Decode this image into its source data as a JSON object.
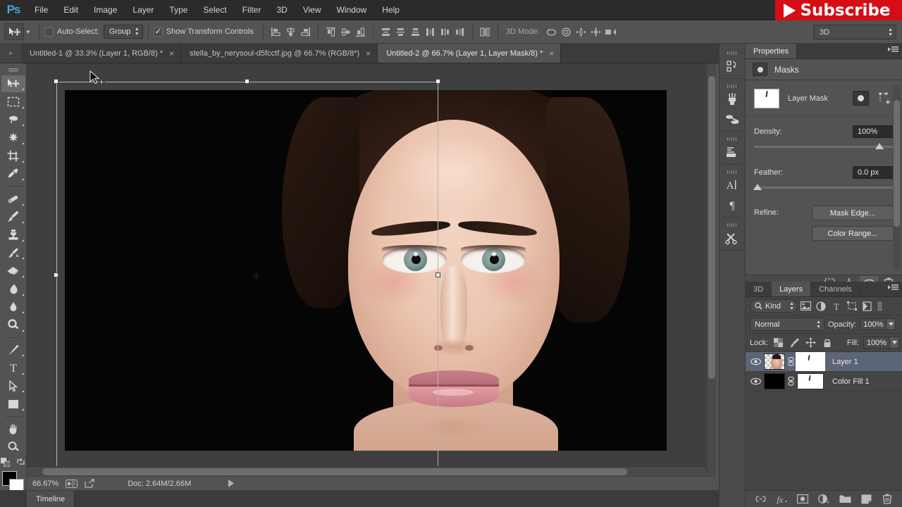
{
  "app": {
    "name": "Adobe Photoshop",
    "logo_text": "Ps"
  },
  "menubar": {
    "items": [
      {
        "label": "File"
      },
      {
        "label": "Edit"
      },
      {
        "label": "Image"
      },
      {
        "label": "Layer"
      },
      {
        "label": "Type"
      },
      {
        "label": "Select"
      },
      {
        "label": "Filter"
      },
      {
        "label": "3D"
      },
      {
        "label": "View"
      },
      {
        "label": "Window"
      },
      {
        "label": "Help"
      }
    ]
  },
  "overlay": {
    "subscribe_label": "Subscribe",
    "color": "#d60d14"
  },
  "options_bar": {
    "tool_icon": "move-tool-icon",
    "auto_select_label": "Auto-Select:",
    "auto_select_checked": false,
    "auto_select_scope": "Group",
    "show_transform_label": "Show Transform Controls",
    "show_transform_checked": true,
    "mode_3d_label": "3D Mode:",
    "workspace": "3D"
  },
  "tabs": {
    "items": [
      {
        "label": "Untitled-1 @ 33.3% (Layer 1, RGB/8) *",
        "active": false
      },
      {
        "label": "stella_by_nerysoul-d5fcctf.jpg @ 66.7% (RGB/8*)",
        "active": false
      },
      {
        "label": "Untitled-2 @ 66.7% (Layer 1, Layer Mask/8) *",
        "active": true
      }
    ],
    "close_glyph": "×"
  },
  "toolbar": {
    "tools": [
      {
        "name": "move-tool",
        "selected": true
      },
      {
        "name": "rectangular-marquee-tool",
        "selected": false
      },
      {
        "name": "lasso-tool",
        "selected": false
      },
      {
        "name": "magic-wand-tool",
        "selected": false
      },
      {
        "name": "crop-tool",
        "selected": false
      },
      {
        "name": "eyedropper-tool",
        "selected": false
      },
      {
        "name": "healing-brush-tool",
        "selected": false
      },
      {
        "name": "brush-tool",
        "selected": false
      },
      {
        "name": "clone-stamp-tool",
        "selected": false
      },
      {
        "name": "history-brush-tool",
        "selected": false
      },
      {
        "name": "eraser-tool",
        "selected": false
      },
      {
        "name": "gradient-tool",
        "selected": false
      },
      {
        "name": "blur-tool",
        "selected": false
      },
      {
        "name": "dodge-tool",
        "selected": false
      },
      {
        "name": "pen-tool",
        "selected": false
      },
      {
        "name": "type-tool",
        "selected": false
      },
      {
        "name": "path-selection-tool",
        "selected": false
      },
      {
        "name": "rectangle-tool",
        "selected": false
      },
      {
        "name": "hand-tool",
        "selected": false
      },
      {
        "name": "zoom-tool",
        "selected": false
      }
    ],
    "foreground_color": "#000000",
    "background_color": "#ffffff"
  },
  "canvas": {
    "document_title": "Untitled-2",
    "background_color": "#050505",
    "transform_active": true
  },
  "status_bar": {
    "zoom": "66.67%",
    "doc_info": "Doc: 2.64M/2.66M"
  },
  "timeline": {
    "tab_label": "Timeline"
  },
  "icon_dock": {
    "items": [
      {
        "name": "history-panel-icon"
      },
      {
        "name": "brushes-panel-icon"
      },
      {
        "name": "clone-source-panel-icon"
      },
      {
        "name": "adjustments-panel-icon"
      },
      {
        "name": "character-panel-icon"
      },
      {
        "name": "paragraph-panel-icon"
      },
      {
        "name": "tool-presets-panel-icon"
      }
    ]
  },
  "properties": {
    "tab_label": "Properties",
    "header_title": "Masks",
    "mask_type_label": "Layer Mask",
    "density": {
      "label": "Density:",
      "value": "100%",
      "slider_percent": 100
    },
    "feather": {
      "label": "Feather:",
      "value": "0.0 px",
      "slider_percent": 0
    },
    "refine": {
      "label": "Refine:",
      "buttons": [
        {
          "label": "Mask Edge..."
        },
        {
          "label": "Color Range..."
        }
      ]
    },
    "footer_icons": [
      {
        "name": "load-selection-icon",
        "active": false
      },
      {
        "name": "apply-mask-icon",
        "active": false
      },
      {
        "name": "toggle-mask-visibility-icon",
        "active": true
      },
      {
        "name": "delete-mask-icon",
        "active": false
      }
    ]
  },
  "layers_panel": {
    "tabs": [
      {
        "label": "3D",
        "active": false
      },
      {
        "label": "Layers",
        "active": true
      },
      {
        "label": "Channels",
        "active": false
      }
    ],
    "filter": {
      "kind_label": "Kind",
      "icons": [
        {
          "name": "filter-pixel-layers-icon"
        },
        {
          "name": "filter-adjustment-layers-icon"
        },
        {
          "name": "filter-type-layers-icon"
        },
        {
          "name": "filter-shape-layers-icon"
        },
        {
          "name": "filter-smart-objects-icon"
        }
      ]
    },
    "blend_mode": "Normal",
    "opacity_label": "Opacity:",
    "opacity_value": "100%",
    "lock_label": "Lock:",
    "lock_icons": [
      {
        "name": "lock-transparent-pixels-icon"
      },
      {
        "name": "lock-image-pixels-icon"
      },
      {
        "name": "lock-position-icon"
      },
      {
        "name": "lock-all-icon"
      }
    ],
    "fill_label": "Fill:",
    "fill_value": "100%",
    "layers": [
      {
        "name": "Layer 1",
        "visible": true,
        "selected": true,
        "thumb_type": "image",
        "linked": true,
        "mask": true,
        "mask_active": true
      },
      {
        "name": "Color Fill 1",
        "visible": true,
        "selected": false,
        "thumb_type": "solid-black",
        "linked": true,
        "mask": true,
        "mask_active": false
      }
    ],
    "footer_icons": [
      {
        "name": "link-layers-icon"
      },
      {
        "name": "layer-style-fx-icon"
      },
      {
        "name": "add-layer-mask-icon"
      },
      {
        "name": "new-adjustment-layer-icon"
      },
      {
        "name": "new-group-icon"
      },
      {
        "name": "new-layer-icon"
      },
      {
        "name": "delete-layer-icon"
      }
    ]
  }
}
